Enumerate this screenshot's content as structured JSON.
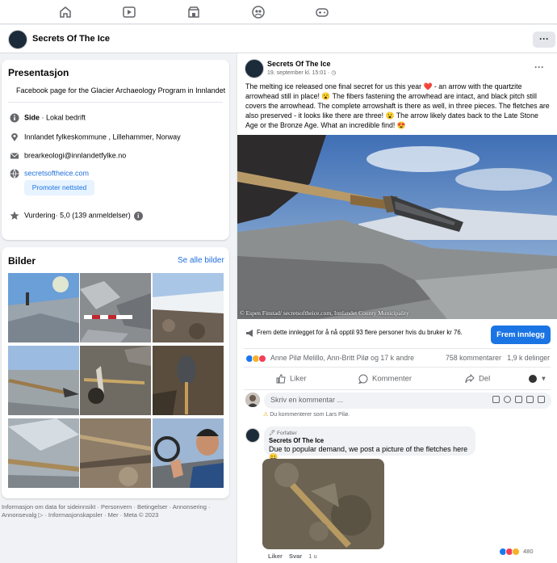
{
  "topnav": {
    "icons": [
      "home-icon",
      "video-icon",
      "marketplace-icon",
      "groups-icon",
      "gaming-icon"
    ]
  },
  "page": {
    "name": "Secrets Of The Ice",
    "more": "···"
  },
  "intro": {
    "title": "Presentasjon",
    "description": "Facebook page for the Glacier Archaeology Program in Innlandet",
    "category_bold": "Side",
    "category_rest": " · Lokal bedrift",
    "address": "Innlandet fylkeskommune , Lillehammer, Norway",
    "email": "brearkeologi@innlandetfylke.no",
    "website": "secretsoftheice.com",
    "promote_label": "Promoter nettsted",
    "rating": "Vurdering· 5,0 (139 anmeldelser)",
    "rating_info": "i"
  },
  "photos": {
    "title": "Bilder",
    "see_all": "Se alle bilder"
  },
  "footer": {
    "text": "Informasjon om data for sideinnsikt · Personvern · Betingelser · Annonsering · Annonsevalg ▷ · Informasjonskapsler · Mer · Meta © 2023"
  },
  "post": {
    "author": "Secrets Of The Ice",
    "time": "19. september kl. 15:01 · ◷",
    "more": "···",
    "text": "The melting ice released one final secret for us this year ❤️ - an arrow with the quartzite arrowhead still in place! 😮 The fibers fastening the arrowhead are intact, and black pitch still covers the arrowhead. The complete arrowshaft is there as well, in three pieces. The fletches are also preserved - it looks like there are three! 😮 The arrow likely dates back to the Late Stone Age or the Bronze Age. What an incredible find! 😍",
    "image_credit": "© Espen Finstad/ secretsoftheice.com, Innlandet County Municipality",
    "boost_text": "Frem dette innlegget for å nå opptil 93 flere personer hvis du bruker kr 76.",
    "boost_button": "Frem innlegg",
    "reactions_text": "Anne Pilø Melillo, Ann-Britt Pilø og 17 k andre",
    "comments_count": "758 kommentarer",
    "shares_count": "1,9 k delinger",
    "like_label": "Liker",
    "comment_label": "Kommenter",
    "share_label": "Del",
    "comment_placeholder": "Skriv en kommentar ...",
    "comment_as": "Du kommenterer som Lars Pilø."
  },
  "reply": {
    "badge": "🖊 Forfatter",
    "author": "Secrets Of The Ice",
    "text": "Due to popular demand, we post a picture of the fletches here😀",
    "like": "Liker",
    "reply": "Svar",
    "age": "1 u",
    "reaction_count": "480"
  },
  "colors": {
    "accent": "#1b74e4",
    "link": "#216fdb",
    "love": "#f33e58",
    "like": "#1877f2",
    "haha": "#f7b125"
  }
}
